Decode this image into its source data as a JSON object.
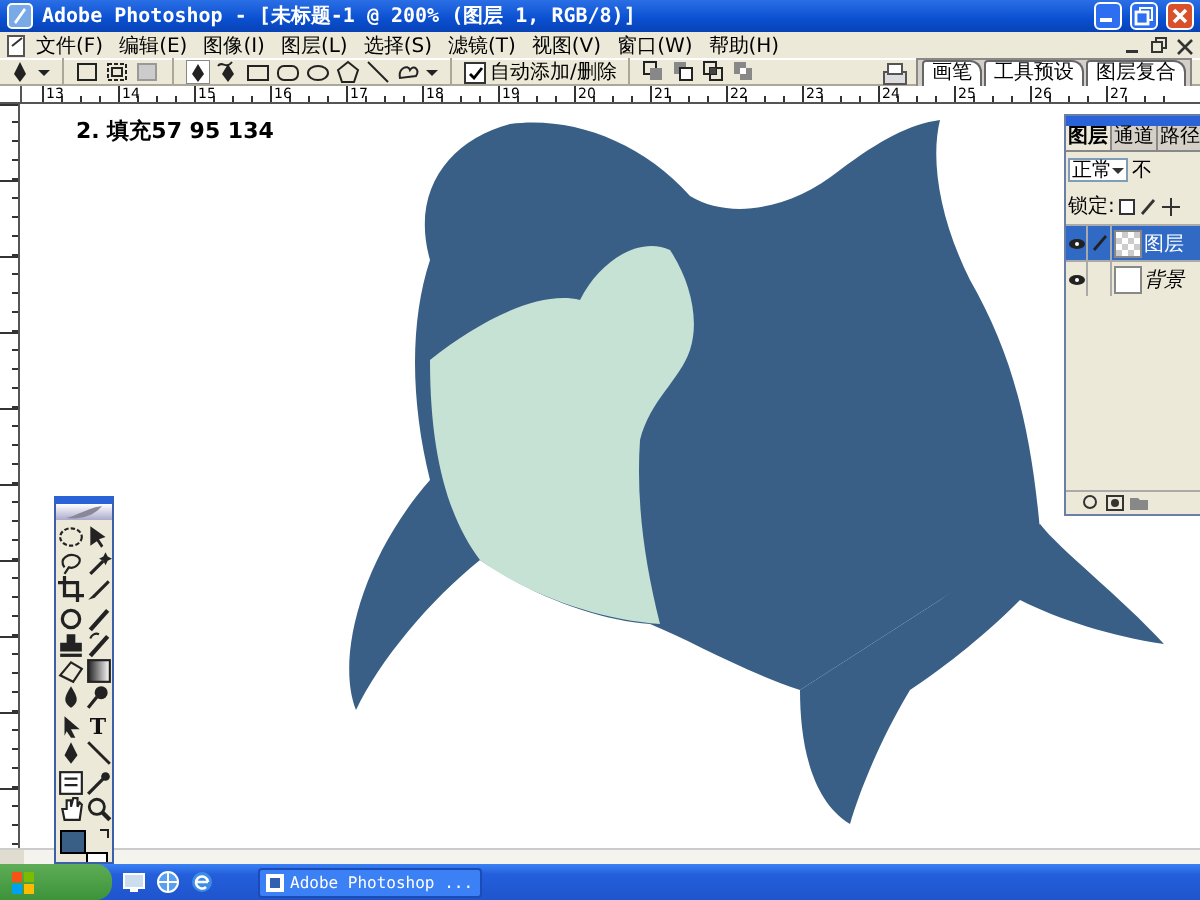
{
  "window": {
    "title": "Adobe Photoshop - [未标题-1 @ 200% (图层 1, RGB/8)]"
  },
  "menu_bar": {
    "items": [
      "文件(F)",
      "编辑(E)",
      "图像(I)",
      "图层(L)",
      "选择(S)",
      "滤镜(T)",
      "视图(V)",
      "窗口(W)",
      "帮助(H)"
    ]
  },
  "options_bar": {
    "auto_add_delete": {
      "label": "自动添加/删除",
      "checked": true
    },
    "palette_tabs": [
      "画笔",
      "工具预设",
      "图层复合"
    ]
  },
  "ruler": {
    "labels": [
      "13",
      "14",
      "15",
      "16",
      "17",
      "18",
      "19",
      "20",
      "21",
      "22",
      "23",
      "24",
      "25",
      "26",
      "27"
    ]
  },
  "canvas": {
    "caption": "2. 填充57 95 134"
  },
  "layers_panel": {
    "tabs": [
      {
        "label": "图层",
        "selected": true
      },
      {
        "label": "通道",
        "selected": false
      },
      {
        "label": "路径",
        "selected": false
      }
    ],
    "blend_mode": "正常",
    "opacity_label": "不",
    "lock_label": "锁定:",
    "layers": [
      {
        "name": "图层",
        "selected": true,
        "kind": "transparent"
      },
      {
        "name": "背景",
        "selected": false,
        "kind": "background"
      }
    ]
  },
  "toolbox": {
    "type_tool_glyph": "T"
  },
  "taskbar": {
    "tasks": [
      "Adobe Photoshop ..."
    ]
  }
}
